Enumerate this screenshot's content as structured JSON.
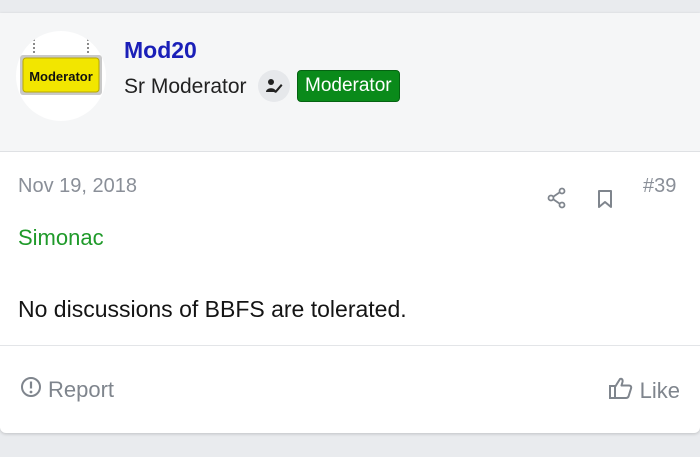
{
  "post": {
    "author": {
      "username": "Mod20",
      "user_title": "Sr Moderator",
      "badge": "Moderator",
      "avatar_text": "Moderator",
      "badge_color": "#0a8a1a",
      "username_color": "#1a1fb8"
    },
    "date": "Nov 19, 2018",
    "number": "#39",
    "mention": "Simonac",
    "message": "No discussions of BBFS are tolerated.",
    "actions": {
      "report_label": "Report",
      "like_label": "Like"
    },
    "icons": [
      "staff-icon",
      "share-icon",
      "bookmark-icon",
      "report-icon",
      "thumbs-up-icon"
    ]
  }
}
